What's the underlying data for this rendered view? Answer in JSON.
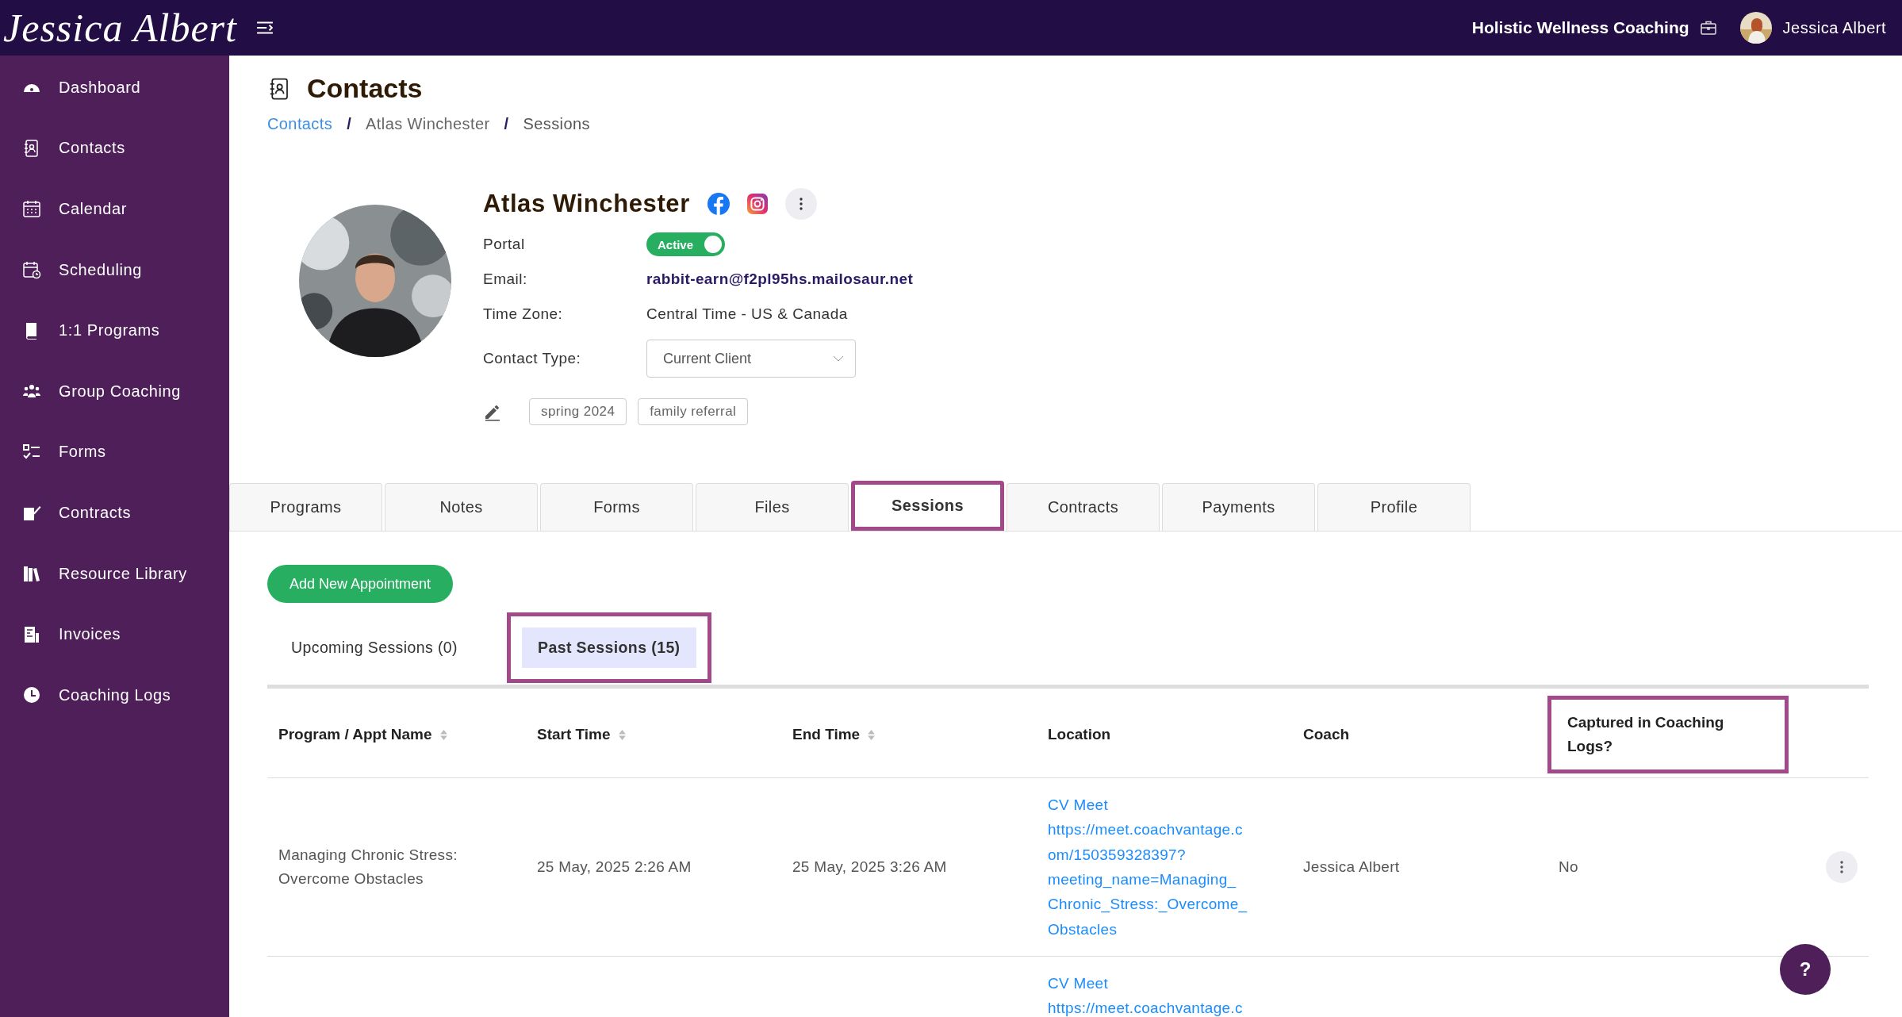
{
  "brand": {
    "logo": "Jessica Albert"
  },
  "topbar": {
    "business": "Holistic Wellness Coaching",
    "user": "Jessica Albert"
  },
  "sidebar": {
    "items": [
      {
        "label": "Dashboard"
      },
      {
        "label": "Contacts"
      },
      {
        "label": "Calendar"
      },
      {
        "label": "Scheduling"
      },
      {
        "label": "1:1 Programs"
      },
      {
        "label": "Group Coaching"
      },
      {
        "label": "Forms"
      },
      {
        "label": "Contracts"
      },
      {
        "label": "Resource Library"
      },
      {
        "label": "Invoices"
      },
      {
        "label": "Coaching Logs"
      }
    ]
  },
  "page": {
    "title": "Contacts",
    "breadcrumb_separator": "/",
    "breadcrumb": [
      {
        "label": "Contacts",
        "kind": "link"
      },
      {
        "label": "Atlas Winchester",
        "kind": "text"
      },
      {
        "label": "Sessions",
        "kind": "current"
      }
    ]
  },
  "contact": {
    "name": "Atlas Winchester",
    "fields": [
      {
        "label": "Portal",
        "kind": "toggle",
        "value": "Active",
        "on": true
      },
      {
        "label": "Email:",
        "kind": "email",
        "value": "rabbit-earn@f2pl95hs.mailosaur.net"
      },
      {
        "label": "Time Zone:",
        "kind": "text",
        "value": "Central Time - US & Canada"
      },
      {
        "label": "Contact Type:",
        "kind": "select",
        "value": "Current Client"
      }
    ],
    "tags": [
      "spring 2024",
      "family referral"
    ]
  },
  "tabs": [
    {
      "label": "Programs",
      "selected": false,
      "highlighted": false
    },
    {
      "label": "Notes",
      "selected": false,
      "highlighted": false
    },
    {
      "label": "Forms",
      "selected": false,
      "highlighted": false
    },
    {
      "label": "Files",
      "selected": false,
      "highlighted": false
    },
    {
      "label": "Sessions",
      "selected": true,
      "highlighted": true
    },
    {
      "label": "Contracts",
      "selected": false,
      "highlighted": false
    },
    {
      "label": "Payments",
      "selected": false,
      "highlighted": false
    },
    {
      "label": "Profile",
      "selected": false,
      "highlighted": false
    }
  ],
  "add_button": "Add New Appointment",
  "session_tabs": [
    {
      "label": "Upcoming Sessions (0)",
      "selected": false,
      "highlighted": false
    },
    {
      "label": "Past Sessions (15)",
      "selected": true,
      "highlighted": true
    }
  ],
  "table": {
    "columns": [
      {
        "label": "Program / Appt Name",
        "sortable": true,
        "highlighted": false
      },
      {
        "label": "Start Time",
        "sortable": true,
        "highlighted": false
      },
      {
        "label": "End Time",
        "sortable": true,
        "highlighted": false
      },
      {
        "label": "Location",
        "sortable": false,
        "highlighted": false
      },
      {
        "label": "Coach",
        "sortable": false,
        "highlighted": false
      },
      {
        "label": "Captured in Coaching Logs?",
        "sortable": false,
        "highlighted": true
      }
    ],
    "rows": [
      {
        "name": "Managing Chronic Stress: Overcome Obstacles",
        "start": "25 May, 2025 2:26 AM",
        "end": "25 May, 2025 3:26 AM",
        "location": [
          "CV Meet",
          "https://meet.coachvantage.c",
          "om/150359328397?",
          "meeting_name=Managing_",
          "Chronic_Stress:_Overcome_",
          "Obstacles"
        ],
        "coach": "Jessica Albert",
        "captured": "No"
      },
      {
        "location": [
          "CV Meet",
          "https://meet.coachvantage.c"
        ]
      }
    ]
  },
  "help_button": "?"
}
